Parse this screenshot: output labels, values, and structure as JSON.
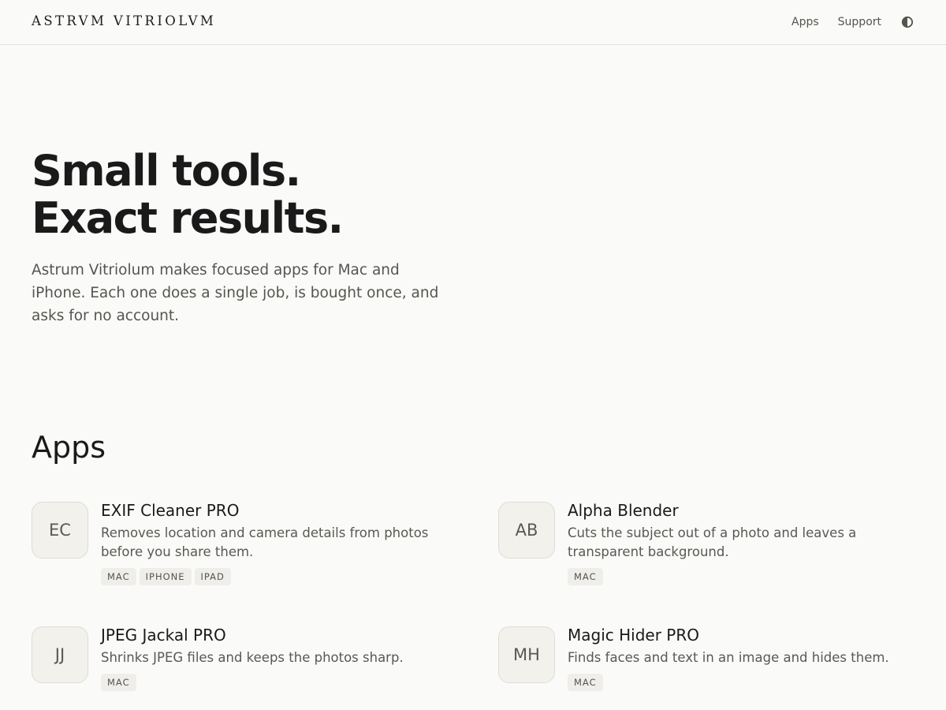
{
  "header": {
    "logo": "ASTRVM VITRIOLVM",
    "nav": [
      {
        "label": "Apps"
      },
      {
        "label": "Support"
      }
    ],
    "theme_toggle_icon": "contrast-icon"
  },
  "hero": {
    "title_line1": "Small tools.",
    "title_line2": "Exact results.",
    "description": "Astrum Vitriolum makes focused apps for Mac and iPhone. Each one does a single job, is bought once, and asks for no account."
  },
  "apps_section": {
    "title": "Apps",
    "apps": [
      {
        "initials": "EC",
        "name": "EXIF Cleaner PRO",
        "description": "Removes location and camera details from photos before you share them.",
        "platforms": [
          "MAC",
          "IPHONE",
          "IPAD"
        ]
      },
      {
        "initials": "AB",
        "name": "Alpha Blender",
        "description": "Cuts the subject out of a photo and leaves a transparent background.",
        "platforms": [
          "MAC"
        ]
      },
      {
        "initials": "JJ",
        "name": "JPEG Jackal PRO",
        "description": "Shrinks JPEG files and keeps the photos sharp.",
        "platforms": [
          "MAC"
        ]
      },
      {
        "initials": "MH",
        "name": "Magic Hider PRO",
        "description": "Finds faces and text in an image and hides them.",
        "platforms": [
          "MAC"
        ]
      }
    ]
  },
  "colors": {
    "background": "#fafaf8",
    "text": "#1a1a1a",
    "muted": "#5a5853",
    "tag_bg": "#efeeea",
    "icon_bg": "#f3f1ec"
  }
}
